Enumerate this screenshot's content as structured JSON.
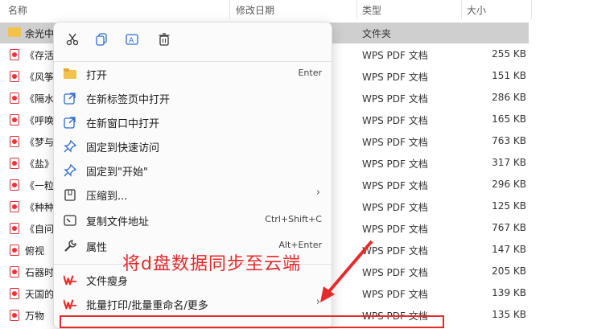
{
  "header": {
    "name": "名称",
    "date": "修改日期",
    "type": "类型",
    "size": "大小"
  },
  "rows": [
    {
      "name": "余光中",
      "type": "文件夹",
      "size": "",
      "folder": true
    },
    {
      "name": "《存活",
      "type": "WPS PDF 文档",
      "size": "255 KB"
    },
    {
      "name": "《风筝",
      "type": "WPS PDF 文档",
      "size": "151 KB"
    },
    {
      "name": "《隔水",
      "type": "WPS PDF 文档",
      "size": "286 KB"
    },
    {
      "name": "《呼唤",
      "type": "WPS PDF 文档",
      "size": "165 KB"
    },
    {
      "name": "《梦与",
      "type": "WPS PDF 文档",
      "size": "763 KB"
    },
    {
      "name": "《盐》",
      "type": "WPS PDF 文档",
      "size": "317 KB"
    },
    {
      "name": "《一粒",
      "type": "WPS PDF 文档",
      "size": "296 KB"
    },
    {
      "name": "《种种",
      "type": "WPS PDF 文档",
      "size": "125 KB"
    },
    {
      "name": "《自问",
      "type": "WPS PDF 文档",
      "size": "767 KB"
    },
    {
      "name": "俯视",
      "type": "WPS PDF 文档",
      "size": "147 KB"
    },
    {
      "name": "石器时",
      "type": "WPS PDF 文档",
      "size": "205 KB"
    },
    {
      "name": "天国的",
      "type": "WPS PDF 文档",
      "size": "139 KB"
    },
    {
      "name": "万物",
      "type": "WPS PDF 文档",
      "size": "135 KB"
    }
  ],
  "menu": {
    "toolbar": [
      "cut-icon",
      "copy-icon",
      "rename-icon",
      "delete-icon"
    ],
    "items": [
      {
        "label": "打开",
        "shortcut": "Enter",
        "icon": "open-folder-icon"
      },
      {
        "label": "在新标签页中打开",
        "shortcut": "",
        "icon": "open-new-tab-icon"
      },
      {
        "label": "在新窗口中打开",
        "shortcut": "",
        "icon": "open-new-window-icon"
      },
      {
        "label": "固定到快速访问",
        "shortcut": "",
        "icon": "pin-icon"
      },
      {
        "label": "固定到\"开始\"",
        "shortcut": "",
        "icon": "pin-start-icon"
      },
      {
        "label": "压缩到...",
        "shortcut": "",
        "icon": "compress-icon",
        "arrow": true
      },
      {
        "label": "复制文件地址",
        "shortcut": "Ctrl+Shift+C",
        "icon": "copy-path-icon"
      },
      {
        "label": "属性",
        "shortcut": "Alt+Enter",
        "icon": "properties-icon"
      },
      {
        "label": "文件瘦身",
        "shortcut": "",
        "icon": "wps-icon"
      },
      {
        "label": "批量打印/批量重命名/更多",
        "shortcut": "",
        "icon": "wps-icon",
        "arrow": true
      }
    ]
  },
  "overlay_text": "将d盘数据同步至云端",
  "colors": {
    "accent": "#e52a2a",
    "selection": "#cfcfcf",
    "folder": "#f3c24a"
  }
}
